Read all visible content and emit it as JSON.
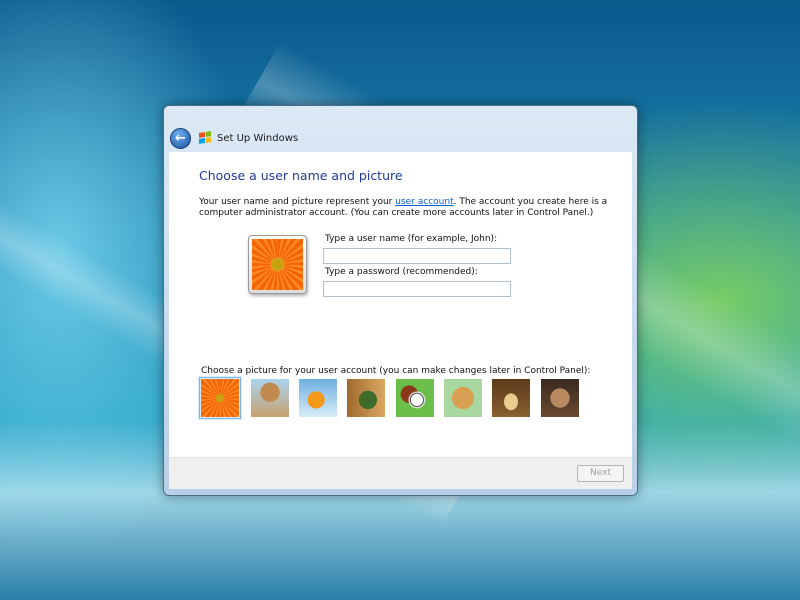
{
  "window": {
    "title": "Set Up Windows"
  },
  "page": {
    "heading": "Choose a user name and picture",
    "desc_before": "Your user name and picture represent your ",
    "desc_link": "user account",
    "desc_after": ". The account you create here is a computer administrator account. (You can create more accounts later in Control Panel.)",
    "username_label": "Type a user name (for example, John):",
    "username_value": "",
    "password_label": "Type a password (recommended):",
    "password_value": "",
    "pictures_label": "Choose a picture for your user account (you can make changes later in Control Panel):",
    "pictures": [
      "flower",
      "robot",
      "goldfish",
      "bonsai",
      "sports-balls",
      "puppy",
      "chess",
      "kitten"
    ],
    "selected_picture": "flower"
  },
  "footer": {
    "next_label": "Next"
  }
}
